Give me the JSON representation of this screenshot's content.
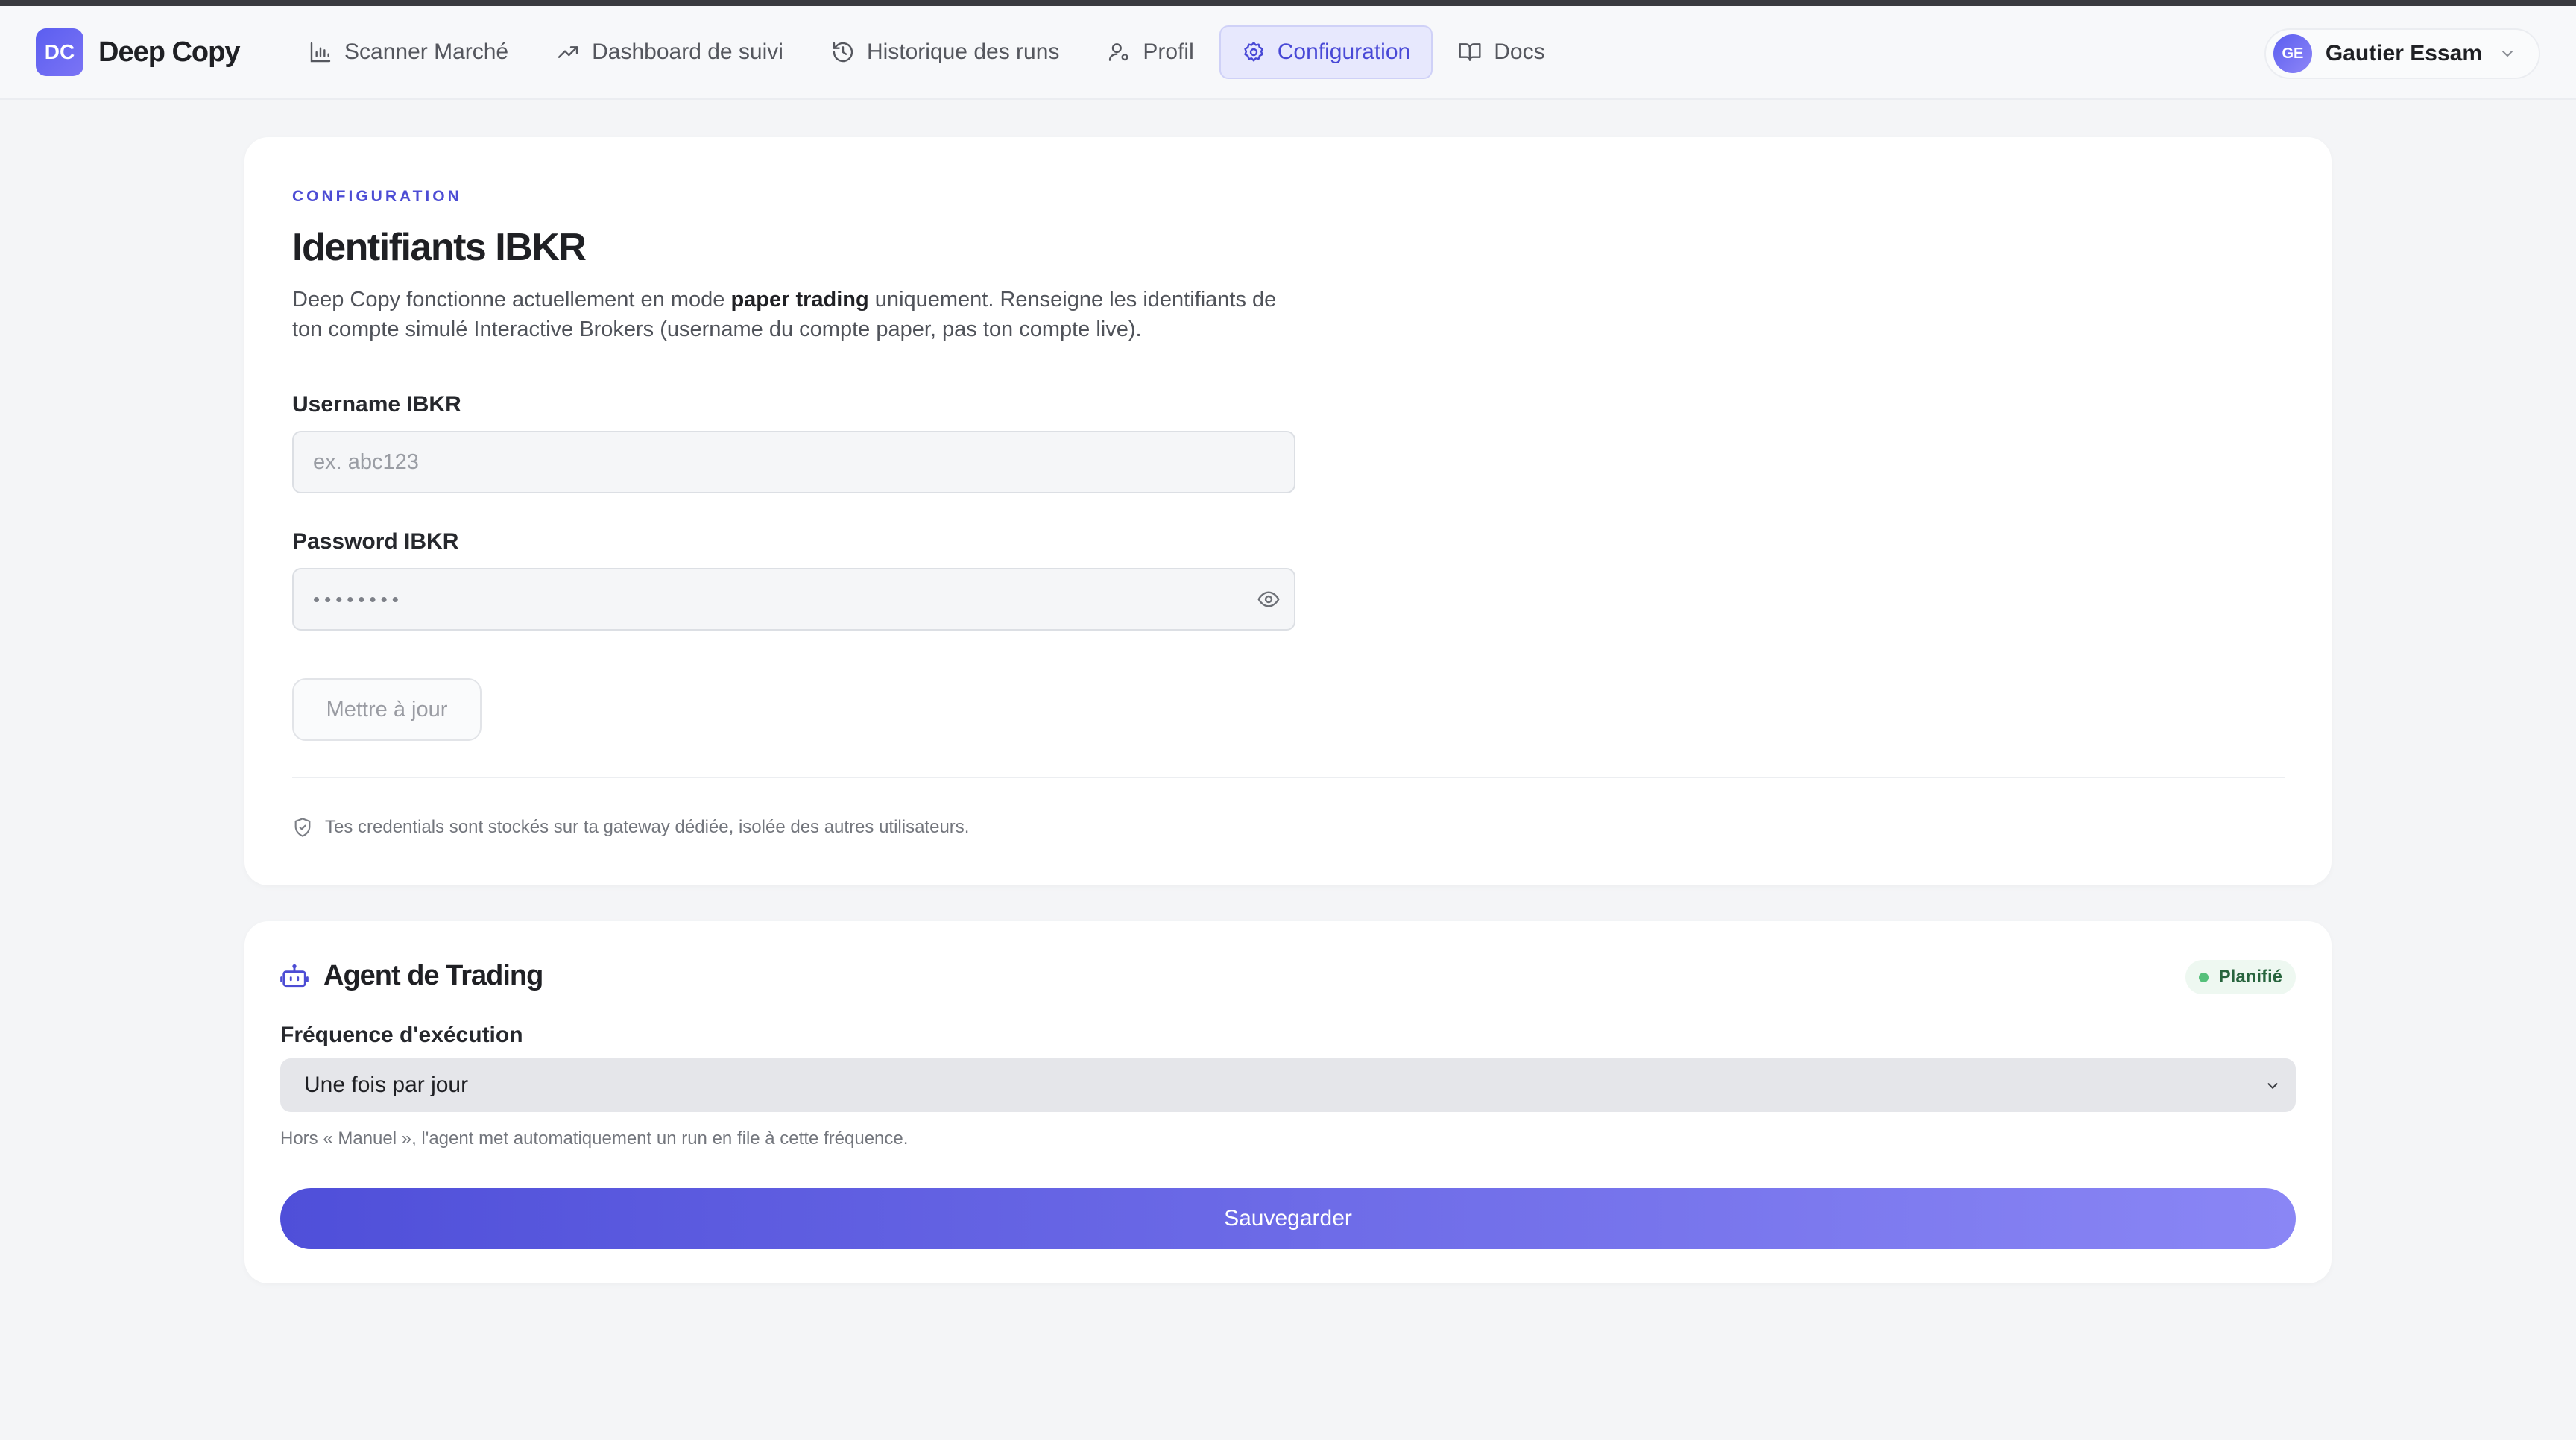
{
  "brand": {
    "logo_text": "DC",
    "name": "Deep Copy",
    "accent": "#5b5ef0"
  },
  "nav": {
    "items": [
      {
        "label": "Scanner Marché",
        "icon": "bar-chart-icon"
      },
      {
        "label": "Dashboard de suivi",
        "icon": "trending-up-icon"
      },
      {
        "label": "Historique des runs",
        "icon": "history-icon"
      },
      {
        "label": "Profil",
        "icon": "user-gear-icon"
      },
      {
        "label": "Configuration",
        "icon": "gear-icon",
        "active": true
      },
      {
        "label": "Docs",
        "icon": "book-icon"
      }
    ]
  },
  "user": {
    "initials": "GE",
    "name": "Gautier Essam"
  },
  "ibkr": {
    "eyebrow": "CONFIGURATION",
    "title": "Identifiants IBKR",
    "desc_before": "Deep Copy fonctionne actuellement en mode ",
    "desc_bold": "paper trading",
    "desc_after": " uniquement. Renseigne les identifiants de ton compte simulé Interactive Brokers (username du compte paper, pas ton compte live).",
    "username_label": "Username IBKR",
    "username_placeholder": "ex. abc123",
    "password_label": "Password IBKR",
    "password_value": "••••••••",
    "update_button": "Mettre à jour",
    "note": "Tes credentials sont stockés sur ta gateway dédiée, isolée des autres utilisateurs."
  },
  "agent": {
    "title": "Agent de Trading",
    "status": "Planifié",
    "status_color": "#55c07a",
    "frequency_label": "Fréquence d'exécution",
    "frequency_selected": "Une fois par jour",
    "hint": "Hors « Manuel », l'agent met automatiquement un run en file à cette fréquence.",
    "save_button": "Sauvegarder"
  }
}
